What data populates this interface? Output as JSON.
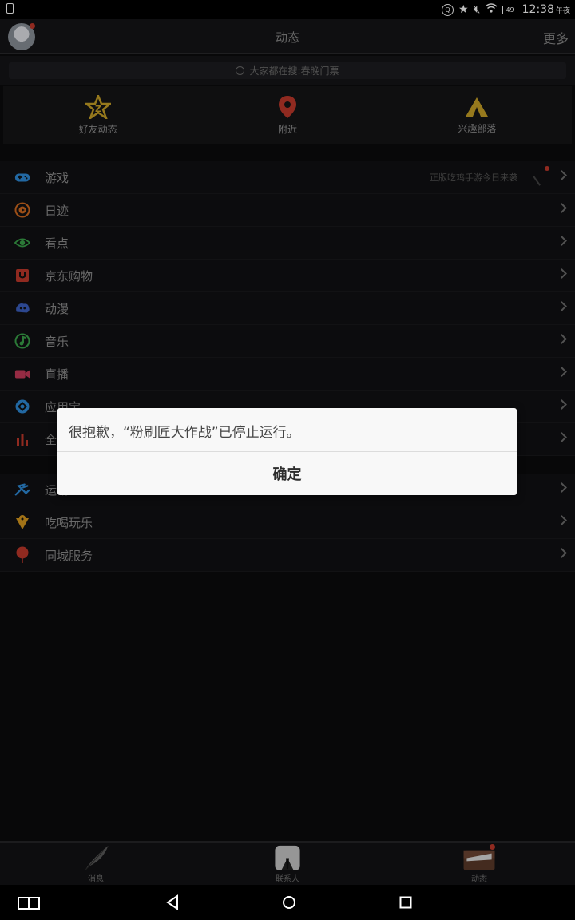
{
  "status": {
    "battery": "49",
    "time": "12:38",
    "ampm": "午夜"
  },
  "header": {
    "title": "动态",
    "more": "更多"
  },
  "search": {
    "placeholder": "大家都在搜:春晚门票"
  },
  "tiles": [
    {
      "label": "好友动态",
      "icon": "qzone-star-icon",
      "color": "#c9a227"
    },
    {
      "label": "附近",
      "icon": "location-pin-icon",
      "color": "#c0392b"
    },
    {
      "label": "兴趣部落",
      "icon": "tent-icon",
      "color": "#c9a227"
    }
  ],
  "list1": [
    {
      "label": "游戏",
      "sub": "正版吃鸡手游今日来袭",
      "icon": "gamepad-icon",
      "color": "#2e8bd8"
    },
    {
      "label": "日迹",
      "icon": "diary-icon",
      "color": "#d26a1f"
    },
    {
      "label": "看点",
      "icon": "eye-icon",
      "color": "#3aa34a"
    },
    {
      "label": "京东购物",
      "icon": "shopping-bag-icon",
      "color": "#c0392b"
    },
    {
      "label": "动漫",
      "icon": "anime-icon",
      "color": "#3b5fbf"
    },
    {
      "label": "音乐",
      "icon": "music-icon",
      "color": "#3aa34a"
    },
    {
      "label": "直播",
      "icon": "camera-icon",
      "color": "#c93a5a"
    },
    {
      "label": "应用宝",
      "icon": "app-store-icon",
      "color": "#2e8bd8"
    },
    {
      "label": "全民K歌",
      "icon": "bar-chart-icon",
      "color": "#c0392b"
    }
  ],
  "list2": [
    {
      "label": "运动",
      "icon": "running-icon",
      "color": "#2e8bd8"
    },
    {
      "label": "吃喝玩乐",
      "icon": "food-icon",
      "color": "#d99a1f"
    },
    {
      "label": "同城服务",
      "icon": "balloon-icon",
      "color": "#c0392b"
    }
  ],
  "dialog": {
    "message": "很抱歉，“粉刷匠大作战”已停止运行。",
    "ok": "确定"
  },
  "tabbar": [
    {
      "label": "消息",
      "icon": "feather-icon"
    },
    {
      "label": "联系人",
      "icon": "contacts-icon"
    },
    {
      "label": "动态",
      "icon": "briefcase-icon"
    }
  ]
}
